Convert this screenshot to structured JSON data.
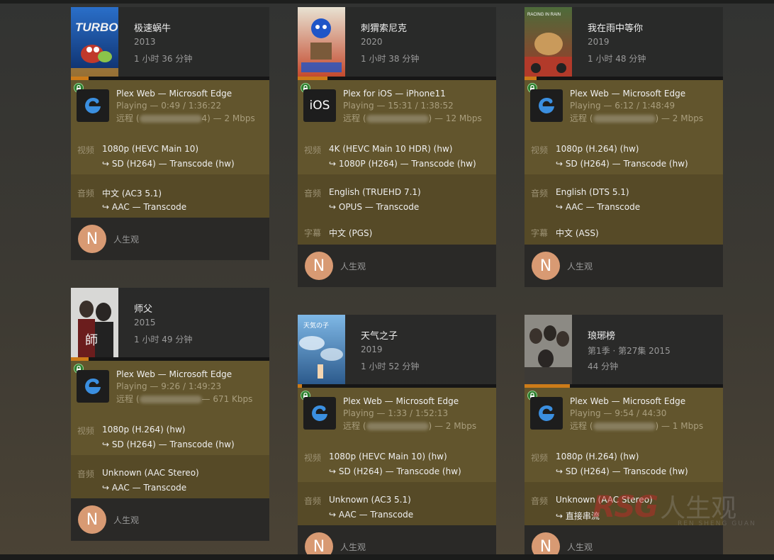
{
  "labels": {
    "video": "视频",
    "audio": "音频",
    "subtitle": "字幕",
    "sep": "—"
  },
  "watermark": {
    "brand": "RSG",
    "text": "人生观",
    "romanized": "REN SHENG GUAN"
  },
  "cards": [
    {
      "title": "极速蜗牛",
      "sub1": "2013",
      "sub2": "1 小时 36 分钟",
      "progress": 0.09,
      "app": "Plex Web",
      "device": "Microsoft Edge",
      "app_icon": "edge-icon",
      "state": "Playing — 0:49 / 1:36:22",
      "remote_prefix": "远程 (",
      "remote_suffix": "4) — 2 Mbps",
      "video_src": "1080p (HEVC Main 10)",
      "video_out": "SD (H264) — Transcode (hw)",
      "audio_src": "中文 (AC3 5.1)",
      "audio_out": "AAC — Transcode",
      "avatar": "N",
      "user": "人生观"
    },
    {
      "title": "刺猬索尼克",
      "sub1": "2020",
      "sub2": "1 小时 38 分钟",
      "progress": 0.15,
      "app": "Plex for iOS",
      "device": "iPhone11",
      "app_icon_text": "iOS",
      "state": "Playing — 15:31 / 1:38:52",
      "remote_prefix": "远程 (",
      "remote_suffix": ") — 12 Mbps",
      "video_src": "4K (HEVC Main 10 HDR) (hw)",
      "video_out": "1080P (H264) — Transcode (hw)",
      "audio_src": "English (TRUEHD 7.1)",
      "audio_out": "OPUS — Transcode",
      "subtitle_src": "中文 (PGS)",
      "avatar": "N",
      "user": "人生观"
    },
    {
      "title": "我在雨中等你",
      "sub1": "2019",
      "sub2": "1 小时 48 分钟",
      "progress": 0.06,
      "app": "Plex Web",
      "device": "Microsoft Edge",
      "app_icon": "edge-icon",
      "state": "Playing — 6:12 / 1:48:49",
      "remote_prefix": "远程 (",
      "remote_suffix": ") — 2 Mbps",
      "video_src": "1080p (H.264) (hw)",
      "video_out": "SD (H264) — Transcode (hw)",
      "audio_src": "English (DTS 5.1)",
      "audio_out": "AAC — Transcode",
      "subtitle_src": "中文 (ASS)",
      "avatar": "N",
      "user": "人生观"
    },
    {
      "title": "师父",
      "sub1": "2015",
      "sub2": "1 小时 49 分钟",
      "progress": 0.09,
      "app": "Plex Web",
      "device": "Microsoft Edge",
      "app_icon": "edge-icon",
      "state": "Playing — 9:26 / 1:49:23",
      "remote_prefix": "远程 (",
      "remote_suffix": "— 671 Kbps",
      "video_src": "1080p (H.264) (hw)",
      "video_out": "SD (H264) — Transcode (hw)",
      "audio_src": "Unknown (AAC Stereo)",
      "audio_out": "AAC — Transcode",
      "avatar": "N",
      "user": "人生观"
    },
    {
      "title": "天气之子",
      "sub1": "2019",
      "sub2": "1 小时 52 分钟",
      "progress": 0.02,
      "app": "Plex Web",
      "device": "Microsoft Edge",
      "app_icon": "edge-icon",
      "state": "Playing — 1:33 / 1:52:13",
      "remote_prefix": "远程 (",
      "remote_suffix": ") — 2 Mbps",
      "video_src": "1080p (HEVC Main 10) (hw)",
      "video_out": "SD (H264) — Transcode (hw)",
      "audio_src": "Unknown (AC3 5.1)",
      "audio_out": "AAC — Transcode",
      "avatar": "N",
      "user": "人生观"
    },
    {
      "title": "琅琊榜",
      "sub1": "第1季 · 第27集 2015",
      "sub2": "44 分钟",
      "progress": 0.23,
      "app": "Plex Web",
      "device": "Microsoft Edge",
      "app_icon": "edge-icon",
      "state": "Playing — 9:54 / 44:30",
      "remote_prefix": "远程 (",
      "remote_suffix": ") — 1 Mbps",
      "video_src": "1080p (H.264) (hw)",
      "video_out": "SD (H264) — Transcode (hw)",
      "audio_src": "Unknown (AAC Stereo)",
      "audio_out": "直接串流",
      "avatar": "N",
      "user": "人生观"
    }
  ]
}
